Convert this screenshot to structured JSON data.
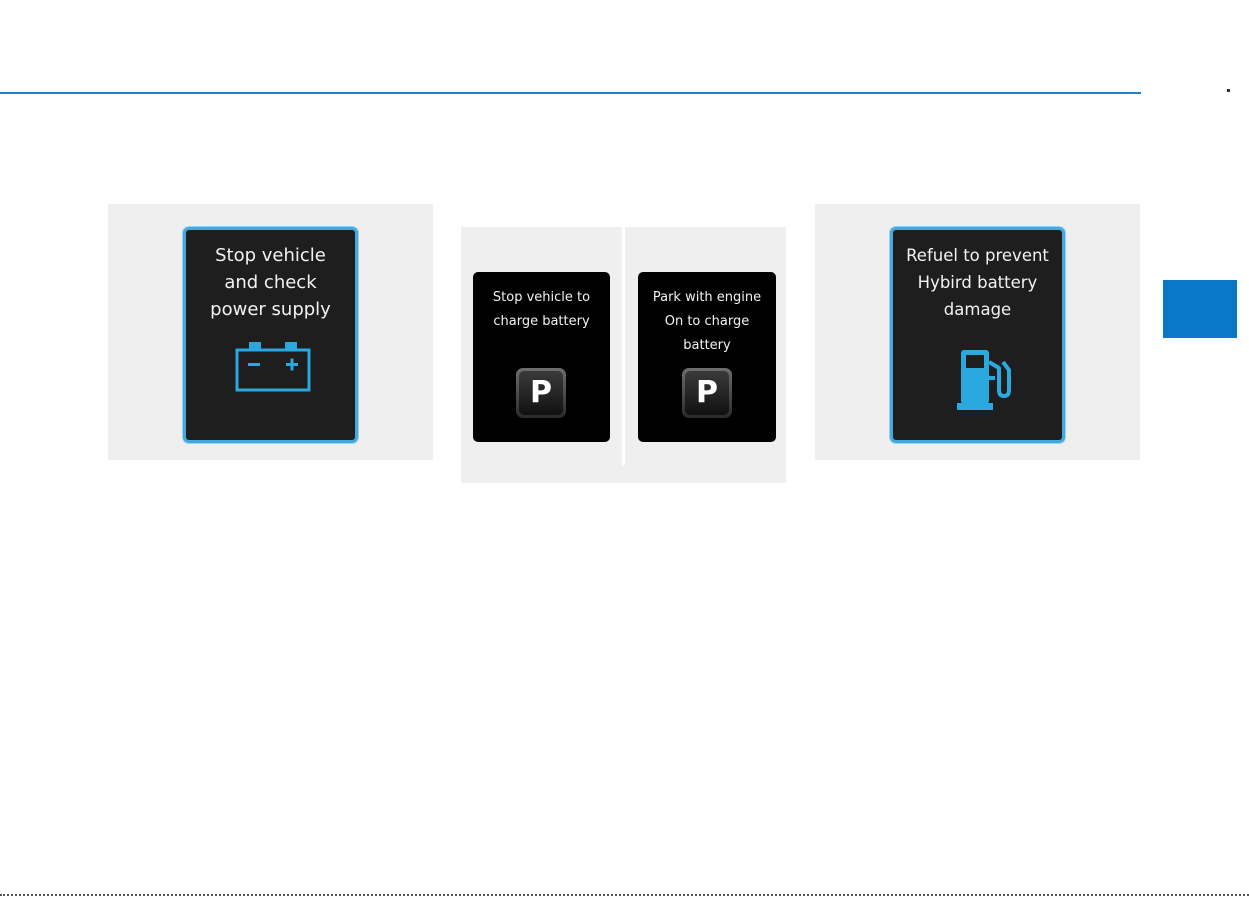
{
  "figures": {
    "left": {
      "message": "Stop vehicle\nand check\npower supply",
      "icon": "battery-icon"
    },
    "middle": {
      "panel_a": {
        "message": "Stop vehicle to\ncharge battery",
        "icon_label": "P"
      },
      "panel_b": {
        "message": "Park with engine\nOn to charge\nbattery",
        "icon_label": "P"
      }
    },
    "right": {
      "message": "Refuel to prevent\nHybird battery\ndamage",
      "icon": "fuel-pump-icon"
    }
  },
  "colors": {
    "accent": "#1f7fcf",
    "chapter_tab": "#0a78c9",
    "screen_border": "#45a7dc",
    "icon_blue": "#2aa8e0",
    "figure_bg": "#efefef"
  }
}
